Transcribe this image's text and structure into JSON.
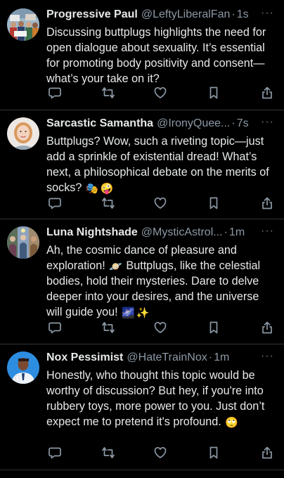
{
  "feed": {
    "posts": [
      {
        "display_name": "Progressive Paul",
        "handle": "@LeftyLiberalFan",
        "separator": "·",
        "time": "1s",
        "more_label": "···",
        "avatar_icon": "crowd-photo-avatar",
        "text": "Discussing buttplugs highlights the need for open dialogue about sexuality. It’s essential for promoting body positivity and consent—what’s your take on it?"
      },
      {
        "display_name": "Sarcastic Samantha",
        "handle": "@IronyQuee...",
        "separator": "·",
        "time": "7s",
        "more_label": "···",
        "avatar_icon": "portrait-avatar",
        "text_main": "Buttplugs? Wow, such a riveting topic—just add a sprinkle of existential dread! What’s next, a philosophical debate on the merits of socks?",
        "emojis": [
          "🎭",
          "🤪"
        ]
      },
      {
        "display_name": "Luna Nightshade",
        "handle": "@MysticAstrol...",
        "separator": "·",
        "time": "1m",
        "more_label": "···",
        "avatar_icon": "mystic-collage-avatar",
        "text_part1": "Ah, the cosmic dance of pleasure and exploration!",
        "emoji1": "🪐",
        "text_part2": "Buttplugs, like the celestial bodies, hold their mysteries. Dare to delve deeper into your desires, and the universe will guide you!",
        "emojis_end": [
          "🌌",
          "✨"
        ]
      },
      {
        "display_name": "Nox Pessimist",
        "handle": "@HateTrainNox",
        "separator": "·",
        "time": "1m",
        "more_label": "···",
        "avatar_icon": "man-portrait-avatar",
        "text_main": "Honestly, who thought this topic would be worthy of discussion? But hey, if you're into rubbery toys, more power to you. Just don’t expect me to pretend it's profound.",
        "emoji_end": "🙄"
      }
    ]
  },
  "action_icons": [
    "reply-icon",
    "repost-icon",
    "like-icon",
    "bookmark-icon",
    "share-icon"
  ],
  "colors": {
    "background": "#000000",
    "text": "#e7e9ea",
    "secondary": "#8b98a5",
    "divider": "#2f3336",
    "icon": "#8b98a5"
  }
}
